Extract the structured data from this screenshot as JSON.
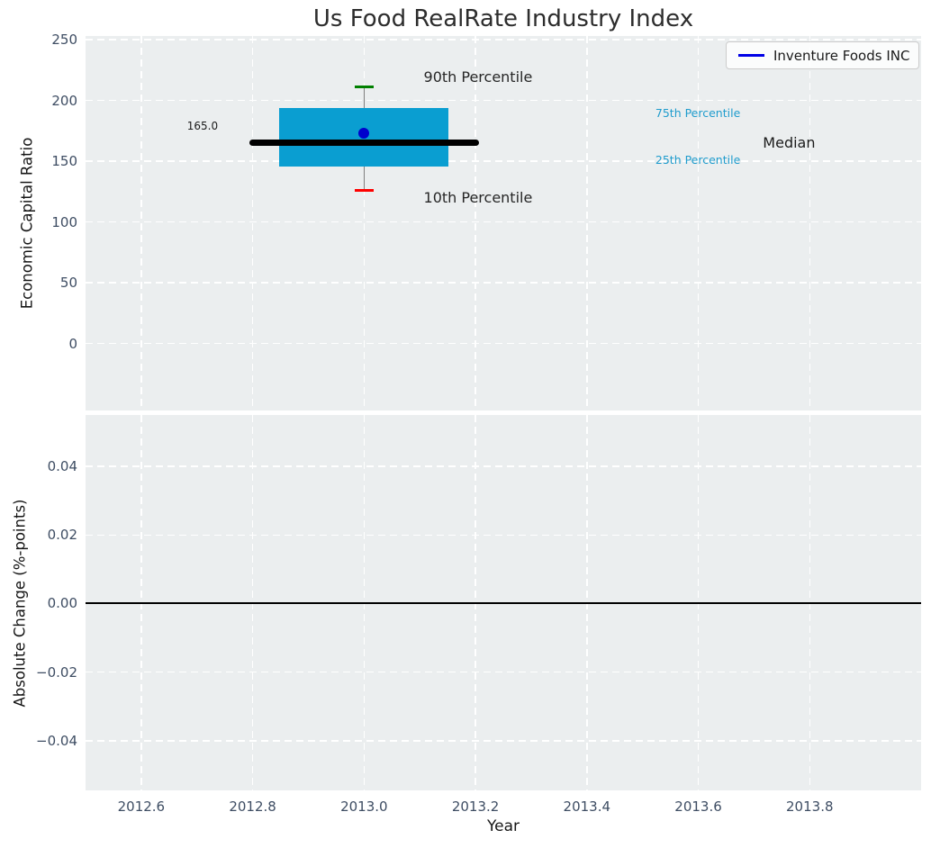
{
  "colors": {
    "plot_bg": "#ebeeef",
    "grid": "#ffffff",
    "title_text": "#2d2d2d",
    "tick_label": "#3e4d63",
    "axis_label": "#161616",
    "box_fill": "#0a9ed1",
    "median_line": "#000000",
    "whisker": "#7f7f7f",
    "cap_90th": "#008000",
    "cap_10th": "#fe0000",
    "company_dot": "#0000cd",
    "zero_line": "#000000",
    "legend_line": "#0000e6",
    "legend_border": "#cccccc",
    "percentile_label": "#1f9ccd"
  },
  "chart_data": [
    {
      "type": "boxplot",
      "title": "Us Food RealRate Industry Index",
      "ylabel": "Economic Capital Ratio",
      "xlim": [
        2012.5,
        2014.0
      ],
      "ylim": [
        -55,
        253
      ],
      "grid": true,
      "xticks": {
        "values": [
          2012.6,
          2012.8,
          2013.0,
          2013.2,
          2013.4,
          2013.6,
          2013.8
        ],
        "labels_visible": false
      },
      "yticks": {
        "values": [
          0,
          50,
          100,
          150,
          200,
          250
        ],
        "labels": [
          "0",
          "50",
          "100",
          "150",
          "200",
          "250"
        ]
      },
      "legend": {
        "position": "upper right",
        "entries": [
          {
            "label": "Inventure Foods INC",
            "color": "#0000e6"
          }
        ]
      },
      "box": {
        "x": 2013.0,
        "p90": 211,
        "p75": 193.5,
        "median": 165.0,
        "p25": 146,
        "p10": 126,
        "company_value": 173,
        "median_label": "165.0",
        "box_half_width": 0.152,
        "median_half_width": 0.206,
        "cap_half_width": 0.0165
      },
      "annotations": [
        {
          "text": "165.0",
          "x": 2012.71,
          "y": 179,
          "size": 12,
          "color": "#1a1a1a",
          "anchor": "middle"
        },
        {
          "text": "90th Percentile",
          "x": 2013.107,
          "y": 219,
          "size": 16,
          "color": "#262626",
          "anchor": "start"
        },
        {
          "text": "10th Percentile",
          "x": 2013.107,
          "y": 120,
          "size": 16,
          "color": "#262626",
          "anchor": "start"
        },
        {
          "text": "75th Percentile",
          "x": 2013.523,
          "y": 189,
          "size": 12.5,
          "color": "#1f9ccd",
          "anchor": "start"
        },
        {
          "text": "25th Percentile",
          "x": 2013.523,
          "y": 151,
          "size": 12.5,
          "color": "#1f9ccd",
          "anchor": "start"
        },
        {
          "text": "Median",
          "x": 2013.716,
          "y": 165,
          "size": 16,
          "color": "#1a1a1a",
          "anchor": "start"
        }
      ]
    },
    {
      "type": "line",
      "ylabel": "Absolute Change (%-points)",
      "xlabel": "Year",
      "xlim": [
        2012.5,
        2014.0
      ],
      "ylim": [
        -0.0545,
        0.055
      ],
      "grid": true,
      "xticks": {
        "values": [
          2012.6,
          2012.8,
          2013.0,
          2013.2,
          2013.4,
          2013.6,
          2013.8
        ],
        "labels": [
          "2012.6",
          "2012.8",
          "2013.0",
          "2013.2",
          "2013.4",
          "2013.6",
          "2013.8"
        ]
      },
      "yticks": {
        "values": [
          0.04,
          0.02,
          0.0,
          -0.02,
          -0.04
        ],
        "labels": [
          "0.04",
          "0.02",
          "0.00",
          "−0.02",
          "−0.04"
        ]
      },
      "zero_line": 0.0,
      "series": []
    }
  ]
}
